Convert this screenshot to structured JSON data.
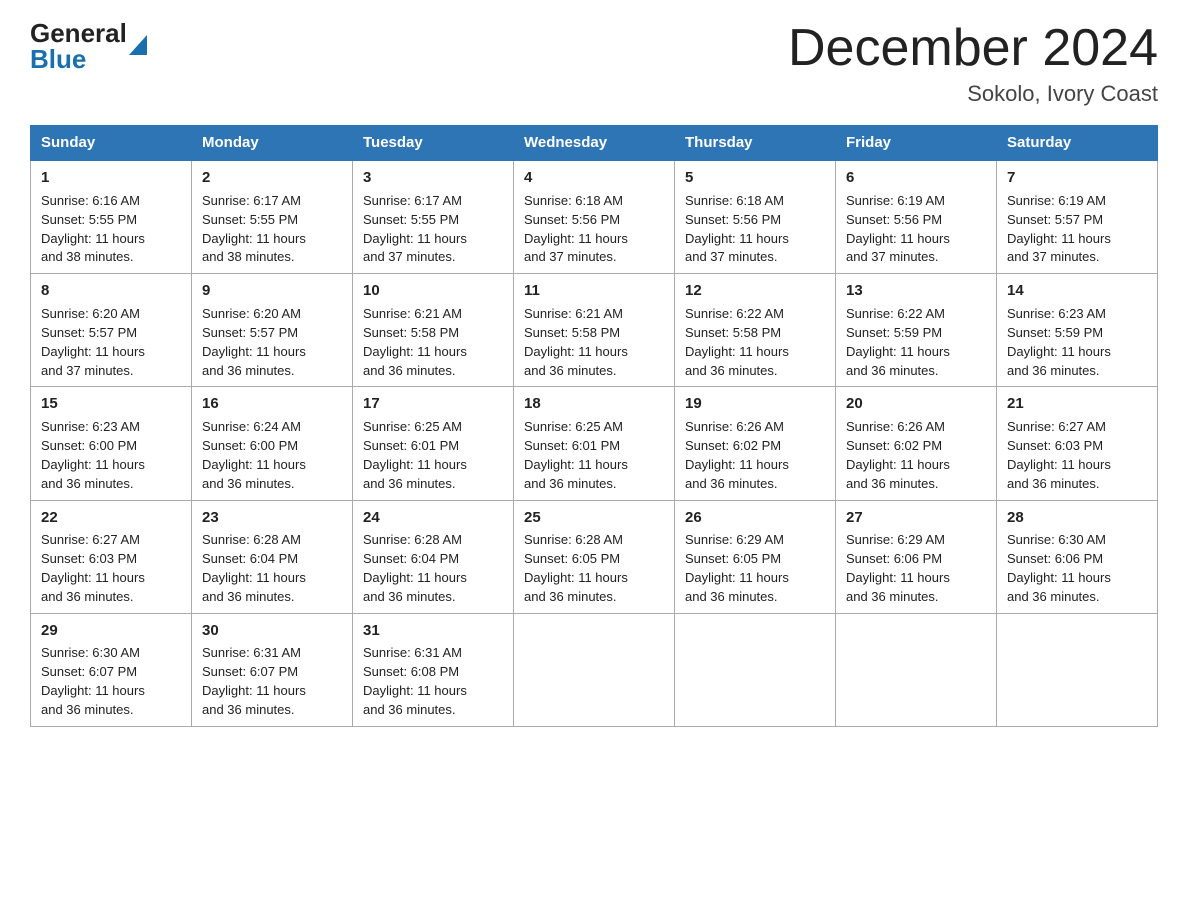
{
  "header": {
    "logo_general": "General",
    "logo_blue": "Blue",
    "page_title": "December 2024",
    "subtitle": "Sokolo, Ivory Coast"
  },
  "calendar": {
    "days_of_week": [
      "Sunday",
      "Monday",
      "Tuesday",
      "Wednesday",
      "Thursday",
      "Friday",
      "Saturday"
    ],
    "weeks": [
      [
        {
          "day": "1",
          "info": "Sunrise: 6:16 AM\nSunset: 5:55 PM\nDaylight: 11 hours\nand 38 minutes."
        },
        {
          "day": "2",
          "info": "Sunrise: 6:17 AM\nSunset: 5:55 PM\nDaylight: 11 hours\nand 38 minutes."
        },
        {
          "day": "3",
          "info": "Sunrise: 6:17 AM\nSunset: 5:55 PM\nDaylight: 11 hours\nand 37 minutes."
        },
        {
          "day": "4",
          "info": "Sunrise: 6:18 AM\nSunset: 5:56 PM\nDaylight: 11 hours\nand 37 minutes."
        },
        {
          "day": "5",
          "info": "Sunrise: 6:18 AM\nSunset: 5:56 PM\nDaylight: 11 hours\nand 37 minutes."
        },
        {
          "day": "6",
          "info": "Sunrise: 6:19 AM\nSunset: 5:56 PM\nDaylight: 11 hours\nand 37 minutes."
        },
        {
          "day": "7",
          "info": "Sunrise: 6:19 AM\nSunset: 5:57 PM\nDaylight: 11 hours\nand 37 minutes."
        }
      ],
      [
        {
          "day": "8",
          "info": "Sunrise: 6:20 AM\nSunset: 5:57 PM\nDaylight: 11 hours\nand 37 minutes."
        },
        {
          "day": "9",
          "info": "Sunrise: 6:20 AM\nSunset: 5:57 PM\nDaylight: 11 hours\nand 36 minutes."
        },
        {
          "day": "10",
          "info": "Sunrise: 6:21 AM\nSunset: 5:58 PM\nDaylight: 11 hours\nand 36 minutes."
        },
        {
          "day": "11",
          "info": "Sunrise: 6:21 AM\nSunset: 5:58 PM\nDaylight: 11 hours\nand 36 minutes."
        },
        {
          "day": "12",
          "info": "Sunrise: 6:22 AM\nSunset: 5:58 PM\nDaylight: 11 hours\nand 36 minutes."
        },
        {
          "day": "13",
          "info": "Sunrise: 6:22 AM\nSunset: 5:59 PM\nDaylight: 11 hours\nand 36 minutes."
        },
        {
          "day": "14",
          "info": "Sunrise: 6:23 AM\nSunset: 5:59 PM\nDaylight: 11 hours\nand 36 minutes."
        }
      ],
      [
        {
          "day": "15",
          "info": "Sunrise: 6:23 AM\nSunset: 6:00 PM\nDaylight: 11 hours\nand 36 minutes."
        },
        {
          "day": "16",
          "info": "Sunrise: 6:24 AM\nSunset: 6:00 PM\nDaylight: 11 hours\nand 36 minutes."
        },
        {
          "day": "17",
          "info": "Sunrise: 6:25 AM\nSunset: 6:01 PM\nDaylight: 11 hours\nand 36 minutes."
        },
        {
          "day": "18",
          "info": "Sunrise: 6:25 AM\nSunset: 6:01 PM\nDaylight: 11 hours\nand 36 minutes."
        },
        {
          "day": "19",
          "info": "Sunrise: 6:26 AM\nSunset: 6:02 PM\nDaylight: 11 hours\nand 36 minutes."
        },
        {
          "day": "20",
          "info": "Sunrise: 6:26 AM\nSunset: 6:02 PM\nDaylight: 11 hours\nand 36 minutes."
        },
        {
          "day": "21",
          "info": "Sunrise: 6:27 AM\nSunset: 6:03 PM\nDaylight: 11 hours\nand 36 minutes."
        }
      ],
      [
        {
          "day": "22",
          "info": "Sunrise: 6:27 AM\nSunset: 6:03 PM\nDaylight: 11 hours\nand 36 minutes."
        },
        {
          "day": "23",
          "info": "Sunrise: 6:28 AM\nSunset: 6:04 PM\nDaylight: 11 hours\nand 36 minutes."
        },
        {
          "day": "24",
          "info": "Sunrise: 6:28 AM\nSunset: 6:04 PM\nDaylight: 11 hours\nand 36 minutes."
        },
        {
          "day": "25",
          "info": "Sunrise: 6:28 AM\nSunset: 6:05 PM\nDaylight: 11 hours\nand 36 minutes."
        },
        {
          "day": "26",
          "info": "Sunrise: 6:29 AM\nSunset: 6:05 PM\nDaylight: 11 hours\nand 36 minutes."
        },
        {
          "day": "27",
          "info": "Sunrise: 6:29 AM\nSunset: 6:06 PM\nDaylight: 11 hours\nand 36 minutes."
        },
        {
          "day": "28",
          "info": "Sunrise: 6:30 AM\nSunset: 6:06 PM\nDaylight: 11 hours\nand 36 minutes."
        }
      ],
      [
        {
          "day": "29",
          "info": "Sunrise: 6:30 AM\nSunset: 6:07 PM\nDaylight: 11 hours\nand 36 minutes."
        },
        {
          "day": "30",
          "info": "Sunrise: 6:31 AM\nSunset: 6:07 PM\nDaylight: 11 hours\nand 36 minutes."
        },
        {
          "day": "31",
          "info": "Sunrise: 6:31 AM\nSunset: 6:08 PM\nDaylight: 11 hours\nand 36 minutes."
        },
        {
          "day": "",
          "info": ""
        },
        {
          "day": "",
          "info": ""
        },
        {
          "day": "",
          "info": ""
        },
        {
          "day": "",
          "info": ""
        }
      ]
    ]
  }
}
